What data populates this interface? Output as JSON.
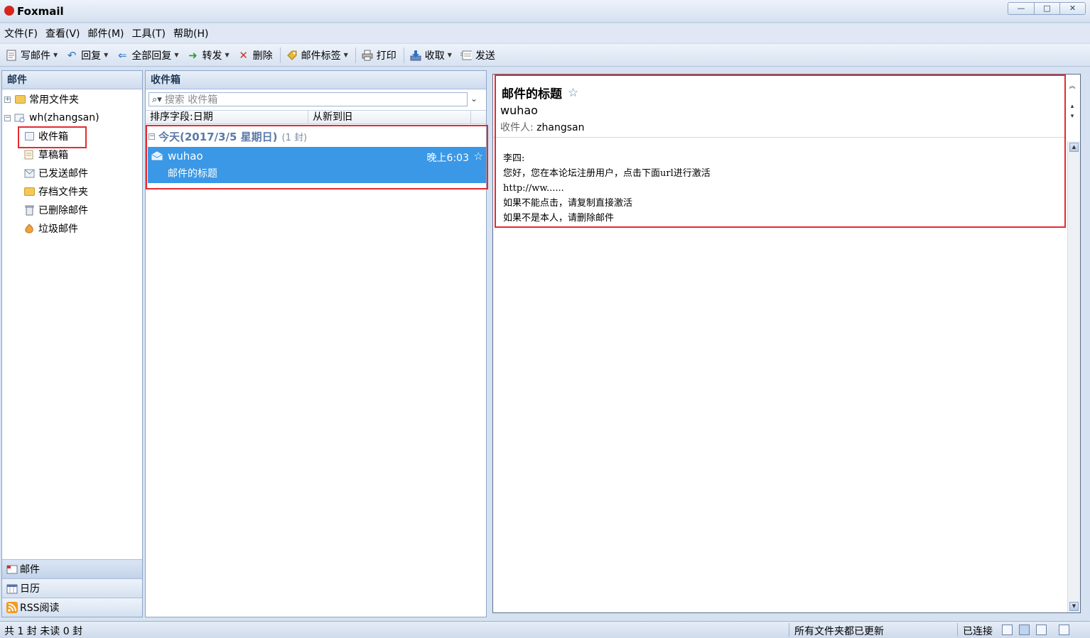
{
  "app": {
    "title": "Foxmail"
  },
  "window_buttons": {
    "minimize": "—",
    "maximize": "□",
    "close": "✕"
  },
  "menu": [
    "文件(F)",
    "查看(V)",
    "邮件(M)",
    "工具(T)",
    "帮助(H)"
  ],
  "toolbar": {
    "compose": "写邮件",
    "reply": "回复",
    "reply_all": "全部回复",
    "forward": "转发",
    "delete": "删除",
    "tag": "邮件标签",
    "print": "打印",
    "receive": "收取",
    "send": "发送"
  },
  "left_panel": {
    "header": "邮件",
    "common_folders": "常用文件夹",
    "account": "wh(zhangsan)",
    "folders": [
      "收件箱",
      "草稿箱",
      "已发送邮件",
      "存档文件夹",
      "已删除邮件",
      "垃圾邮件"
    ],
    "bottom_tabs": [
      "邮件",
      "日历",
      "RSS阅读"
    ]
  },
  "list_panel": {
    "header": "收件箱",
    "search_placeholder": "搜索 收件箱",
    "sort_field": "排序字段:日期",
    "sort_order": "从新到旧",
    "group_title": "今天(2017/3/5 星期日)",
    "group_count": "(1 封)",
    "mail": {
      "from": "wuhao",
      "time": "晚上6:03",
      "subject": "邮件的标题"
    }
  },
  "reader": {
    "subject": "邮件的标题",
    "from": "wuhao",
    "to_label": "收件人:",
    "to": "zhangsan",
    "body": [
      "李四:",
      "您好，您在本论坛注册用户，点击下面url进行激活",
      "http://ww......",
      "如果不能点击，请复制直接激活",
      "如果不是本人，请删除邮件"
    ]
  },
  "status": {
    "counts": "共 1 封 未读 0 封",
    "updated": "所有文件夹都已更新",
    "connection": "已连接"
  },
  "colors": {
    "selection": "#3a98e6",
    "highlight_box": "#e32b30",
    "folder": "#f3c75a"
  }
}
